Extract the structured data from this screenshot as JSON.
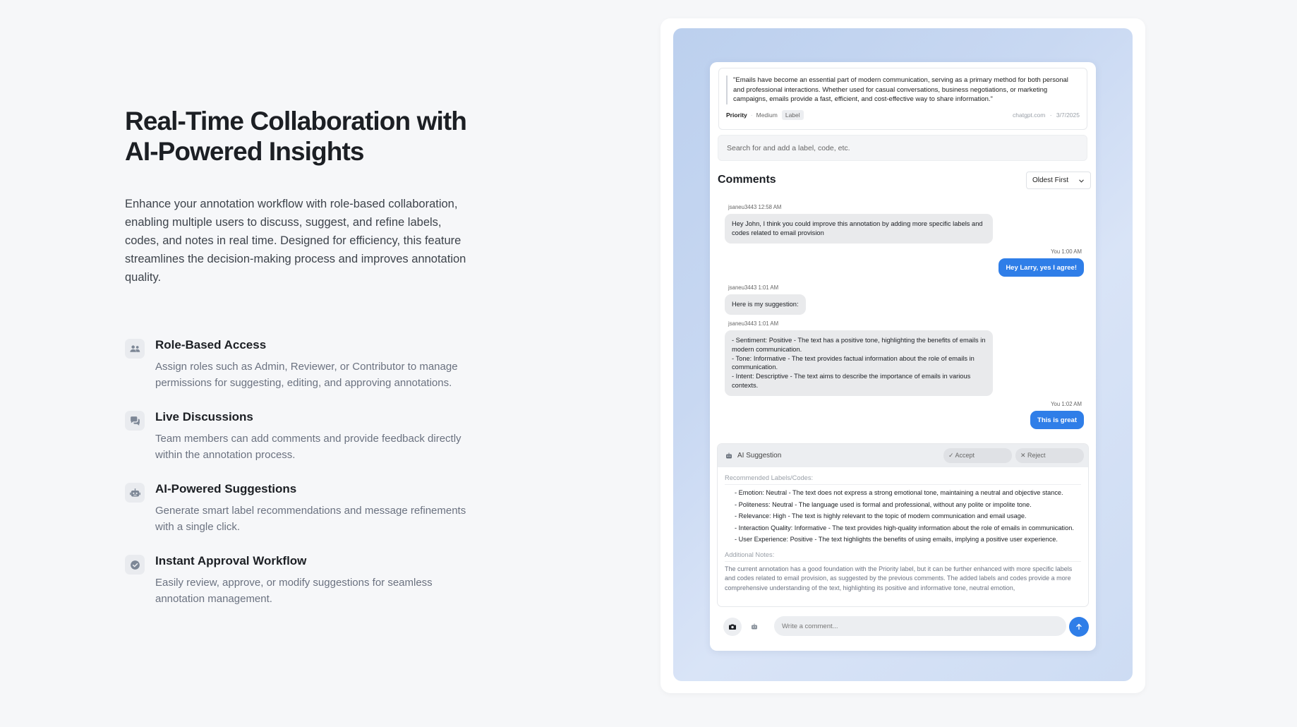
{
  "hero": {
    "title": "Real-Time Collaboration with AI-Powered Insights",
    "description": "Enhance your annotation workflow with role-based collaboration, enabling multiple users to discuss, suggest, and refine labels, codes, and notes in real time. Designed for efficiency, this feature streamlines the decision-making process and improves annotation quality."
  },
  "features": [
    {
      "icon": "users-icon",
      "title": "Role-Based Access",
      "description": "Assign roles such as Admin, Reviewer, or Contributor to manage permissions for suggesting, editing, and approving annotations."
    },
    {
      "icon": "chat-bubbles-icon",
      "title": "Live Discussions",
      "description": "Team members can add comments and provide feedback directly within the annotation process."
    },
    {
      "icon": "robot-icon",
      "title": "AI-Powered Suggestions",
      "description": "Generate smart label recommendations and message refinements with a single click."
    },
    {
      "icon": "check-badge-icon",
      "title": "Instant Approval Workflow",
      "description": "Easily review, approve, or modify suggestions for seamless annotation management."
    }
  ],
  "app": {
    "quote": "\"Emails have become an essential part of modern communication, serving as a primary method for both personal and professional interactions. Whether used for casual conversations, business negotiations, or marketing campaigns, emails provide a fast, efficient, and cost-effective way to share information.\"",
    "meta": {
      "priority_label": "Priority",
      "separator": "·",
      "priority_value": "Medium",
      "label_tag": "Label",
      "source": "chatgpt.com",
      "date": "3/7/2025"
    },
    "search_placeholder": "Search for and add a label, code, etc.",
    "comments_title": "Comments",
    "sort_value": "Oldest First",
    "messages": [
      {
        "meta": "jsaneu3443 12:58 AM",
        "text": "Hey John, I think you could improve this annotation by adding more specific labels and codes related to email provision"
      },
      {
        "meta": "You 1:00 AM",
        "text": "Hey Larry, yes I agree!"
      },
      {
        "meta": "jsaneu3443 1:01 AM",
        "text": "Here is my suggestion:"
      },
      {
        "meta": "jsaneu3443 1:01 AM",
        "lines": [
          "- Sentiment: Positive - The text has a positive tone, highlighting the benefits of emails in modern communication.",
          "- Tone: Informative - The text provides factual information about the role of emails in communication.",
          "- Intent: Descriptive - The text aims to describe the importance of emails in various contexts."
        ]
      },
      {
        "meta": "You 1:02 AM",
        "text": "This is great"
      }
    ],
    "ai": {
      "title": "AI Suggestion",
      "accept": "✓ Accept",
      "reject": "✕ Reject",
      "recommended_label": "Recommended Labels/Codes:",
      "recommendations": [
        "- Emotion: Neutral - The text does not express a strong emotional tone, maintaining a neutral and objective stance.",
        "- Politeness: Neutral - The language used is formal and professional, without any polite or impolite tone.",
        "- Relevance: High - The text is highly relevant to the topic of modern communication and email usage.",
        "- Interaction Quality: Informative - The text provides high-quality information about the role of emails in communication.",
        "- User Experience: Positive - The text highlights the benefits of using emails, implying a positive user experience."
      ],
      "notes_label": "Additional Notes:",
      "notes": "The current annotation has a good foundation with the Priority label, but it can be further enhanced with more specific labels and codes related to email provision, as suggested by the previous comments. The added labels and codes provide a more comprehensive understanding of the text, highlighting its positive and informative tone, neutral emotion,"
    },
    "composer_placeholder": "Write a comment..."
  },
  "colors": {
    "accent": "#2f7ee8",
    "bubble_in": "#e9eaec",
    "gradient_start": "#bcd0ee",
    "gradient_end": "#d9e4f7"
  }
}
